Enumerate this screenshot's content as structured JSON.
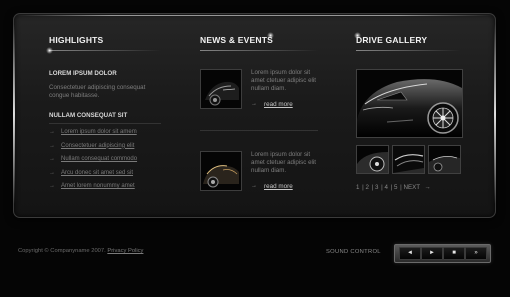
{
  "highlights": {
    "title": "HIGHLIGHTS",
    "subtitle1": "LOREM IPSUM DOLOR",
    "text1": "Consectetuer adipiscing consequat congue habitasse.",
    "subtitle2": "NULLAM CONSEQUAT SIT",
    "links": [
      "Lorem ipsum dolor sit amem",
      "Consectetuer adipiscing elit",
      "Nullam consequat commodo",
      "Arcu donec sit amet sed sit",
      "Amet lorem nonummy amet"
    ]
  },
  "news": {
    "title": "NEWS & EVENTS",
    "items": [
      {
        "text": "Lorem ipsum dolor sit amet ctetuer adipisc elit nullam diam.",
        "link": "read more"
      },
      {
        "text": "Lorem ipsum dolor sit amet ctetuer adipisc elit nullam diam.",
        "link": "read more"
      }
    ]
  },
  "gallery": {
    "title": "DRIVE GALLERY",
    "pages": [
      "1",
      "2",
      "3",
      "4",
      "5"
    ],
    "next": "NEXT"
  },
  "footer": {
    "copyright": "Copyright © Companyname 2007.",
    "privacy": "Privacy Policy"
  },
  "sound": {
    "label": "SOUND CONTROL",
    "buttons": [
      "◄",
      "►",
      "■",
      "»"
    ]
  },
  "colors": {
    "background": "#050505",
    "panel": "#1e1e1e",
    "heading": "#f2f2f2",
    "text": "#7e7e7e"
  }
}
